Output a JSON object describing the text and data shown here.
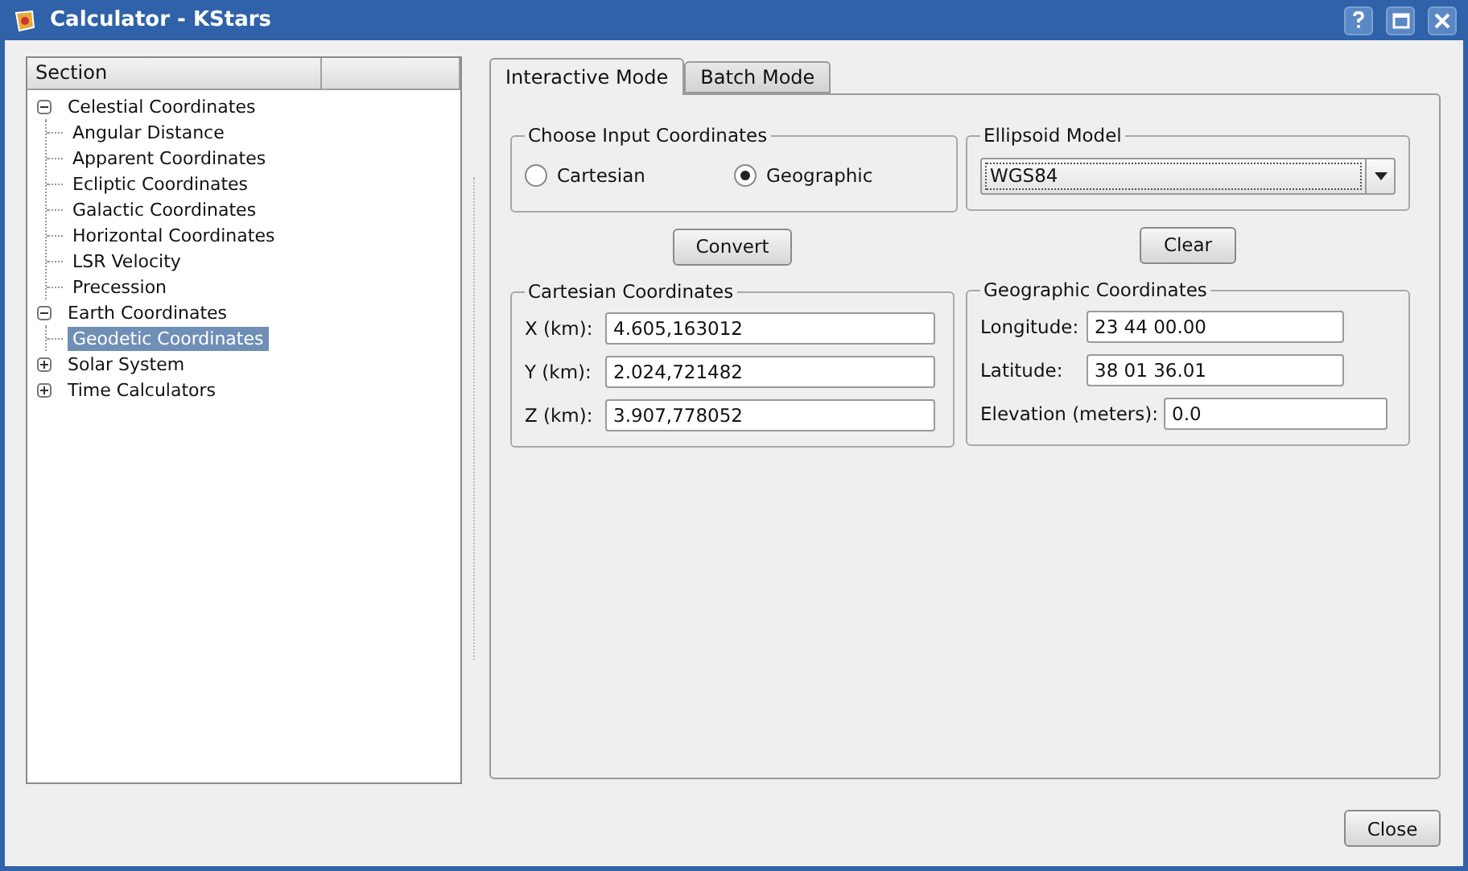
{
  "window": {
    "title": "Calculator - KStars"
  },
  "tree": {
    "columns": [
      "Section"
    ],
    "items": [
      {
        "label": "Celestial Coordinates",
        "expanded": true,
        "selected": false,
        "children": [
          {
            "label": "Angular Distance",
            "selected": false
          },
          {
            "label": "Apparent Coordinates",
            "selected": false
          },
          {
            "label": "Ecliptic Coordinates",
            "selected": false
          },
          {
            "label": "Galactic Coordinates",
            "selected": false
          },
          {
            "label": "Horizontal Coordinates",
            "selected": false
          },
          {
            "label": "LSR Velocity",
            "selected": false
          },
          {
            "label": "Precession",
            "selected": false
          }
        ]
      },
      {
        "label": "Earth Coordinates",
        "expanded": true,
        "selected": false,
        "children": [
          {
            "label": "Geodetic Coordinates",
            "selected": true
          }
        ]
      },
      {
        "label": "Solar System",
        "expanded": false,
        "selected": false
      },
      {
        "label": "Time Calculators",
        "expanded": false,
        "selected": false
      }
    ]
  },
  "tabs": [
    {
      "label": "Interactive Mode",
      "selected": true
    },
    {
      "label": "Batch Mode",
      "selected": false
    }
  ],
  "input_coordinates": {
    "title": "Choose Input Coordinates",
    "options": [
      {
        "label": "Cartesian",
        "selected": false
      },
      {
        "label": "Geographic",
        "selected": true
      }
    ]
  },
  "ellipsoid_model": {
    "title": "Ellipsoid Model",
    "value": "WGS84"
  },
  "convert_button": "Convert",
  "clear_button": "Clear",
  "cartesian": {
    "title": "Cartesian Coordinates",
    "fields": [
      {
        "label": "X (km):",
        "value": "4.605,163012"
      },
      {
        "label": "Y (km):",
        "value": "2.024,721482"
      },
      {
        "label": "Z (km):",
        "value": "3.907,778052"
      }
    ]
  },
  "geographic": {
    "title": "Geographic Coordinates",
    "fields": [
      {
        "label": "Longitude:",
        "value": "23 44 00.00"
      },
      {
        "label": "Latitude:",
        "value": "38 01 36.01"
      },
      {
        "label": "Elevation (meters):",
        "value": "0.0"
      }
    ]
  },
  "close_button": "Close"
}
